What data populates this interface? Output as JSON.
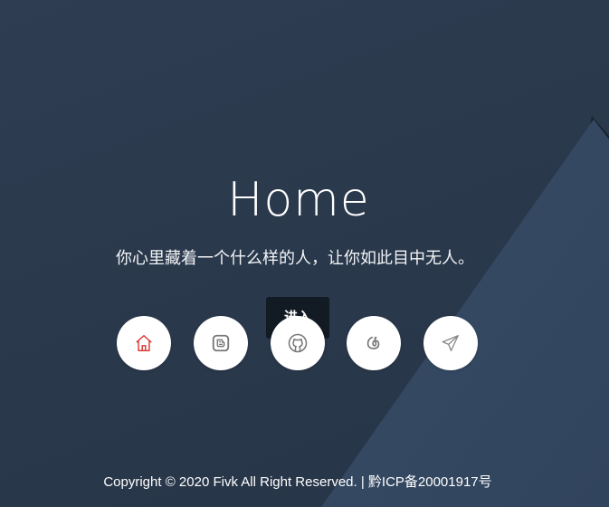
{
  "hero": {
    "title": "Home",
    "subtitle": "你心里藏着一个什么样的人，让你如此目中无人。",
    "enter_label": "进入"
  },
  "links": [
    {
      "icon": "home-icon",
      "color": "#d9302b"
    },
    {
      "icon": "blogger-icon",
      "color": "#7a7a7a"
    },
    {
      "icon": "github-icon",
      "color": "#7a7a7a"
    },
    {
      "icon": "netease-music-icon",
      "color": "#7a7a7a"
    },
    {
      "icon": "telegram-icon",
      "color": "#7a7a7a"
    }
  ],
  "footer": {
    "copyright": "Copyright © 2020 Fivk All Right Reserved. | 黔ICP备20001917号"
  },
  "colors": {
    "background": "#2b3a4e",
    "triangle": "#344862",
    "button_bg": "#121a24"
  }
}
